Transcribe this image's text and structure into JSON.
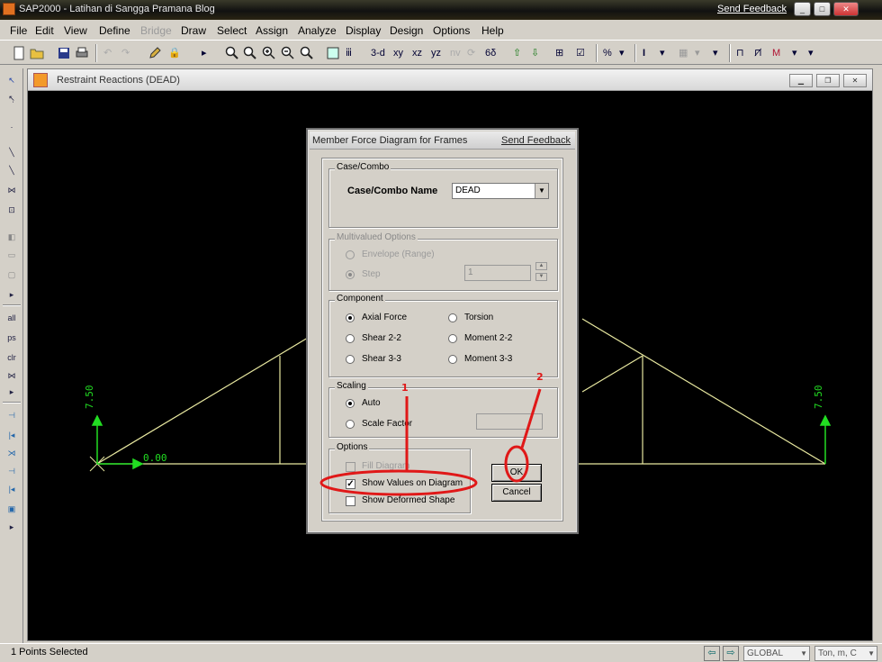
{
  "window": {
    "title": "SAP2000 - Latihan di Sangga Pramana Blog",
    "feedback": "Send Feedback",
    "min": "_",
    "max": "□",
    "close": "✕"
  },
  "menu": {
    "file": "File",
    "edit": "Edit",
    "view": "View",
    "define": "Define",
    "bridge": "Bridge",
    "draw": "Draw",
    "select": "Select",
    "assign": "Assign",
    "analyze": "Analyze",
    "display": "Display",
    "design": "Design",
    "options": "Options",
    "help": "Help"
  },
  "toolbar": {
    "view_3d": "3-d",
    "view_xy": "xy",
    "view_xz": "xz",
    "view_yz": "yz",
    "view_nv": "nv"
  },
  "lefttoolbar": {
    "all": "all",
    "ps": "ps",
    "clr": "clr"
  },
  "child": {
    "title": "Restraint Reactions  (DEAD)",
    "labels": {
      "left_vertical": "7.50",
      "left_horizontal": "0.00",
      "right_vertical": "7.50"
    }
  },
  "dialog": {
    "title": "Member Force Diagram for Frames",
    "feedback": "Send Feedback",
    "case_group": "Case/Combo",
    "case_label": "Case/Combo Name",
    "case_value": "DEAD",
    "multivalued_group": "Multivalued Options",
    "envelope": "Envelope (Range)",
    "step": "Step",
    "step_value": "1",
    "component_group": "Component",
    "axial": "Axial Force",
    "torsion": "Torsion",
    "shear22": "Shear 2-2",
    "moment22": "Moment 2-2",
    "shear33": "Shear 3-3",
    "moment33": "Moment 3-3",
    "scaling_group": "Scaling",
    "auto": "Auto",
    "scale_factor": "Scale Factor",
    "options_group": "Options",
    "fill_diagram": "Fill Diagram",
    "show_values": "Show Values on Diagram",
    "show_deformed": "Show Deformed Shape",
    "ok": "OK",
    "cancel": "Cancel"
  },
  "annotations": {
    "one": "1",
    "two": "2"
  },
  "status": {
    "message": "1 Points Selected",
    "coord_system": "GLOBAL",
    "units": "Ton, m, C"
  },
  "colors": {
    "frame": "#e8e8a0",
    "reaction": "#22dd22",
    "annotation": "#e01818"
  }
}
